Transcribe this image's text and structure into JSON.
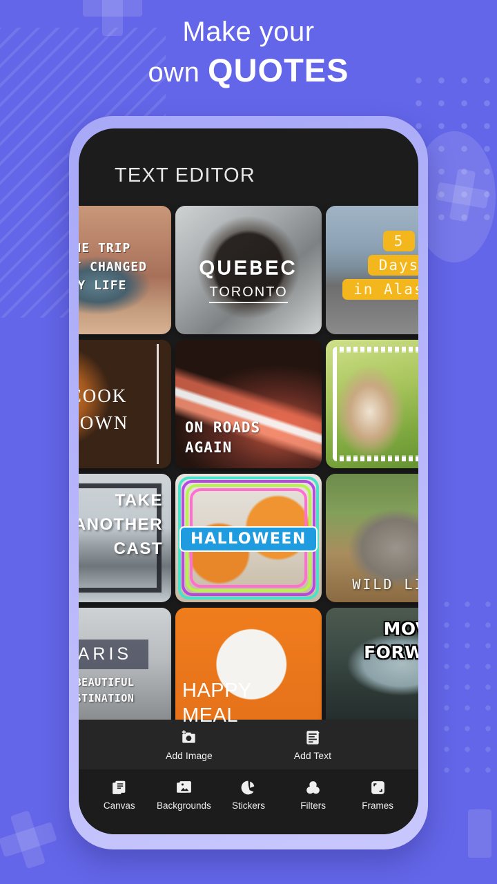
{
  "promo": {
    "line1": "Make your",
    "line2_prefix": "own ",
    "line2_emphasis": "QUOTES",
    "background_color": "#6366e8",
    "phone_frame_color": "#b6b5fb"
  },
  "app": {
    "screen_title": "TEXT EDITOR",
    "screen_background": "#1c1c1c"
  },
  "gallery": {
    "rows": [
      [
        {
          "id": "card-trip",
          "photo": "canyon",
          "lines": [
            "THE TRIP",
            "THAT CHANGED",
            "MY LIFE"
          ]
        },
        {
          "id": "card-quebec",
          "photo": "quebec-circle",
          "title": "QUEBEC",
          "subtitle": "TORONTO"
        },
        {
          "id": "card-alaska",
          "photo": "snow-road",
          "lines": [
            "5",
            "Days",
            "in Alaska"
          ],
          "highlight_color": "#f3b61c"
        }
      ],
      [
        {
          "id": "card-cooktown",
          "photo": "dog",
          "lines": [
            "COOK",
            "TOWN"
          ]
        },
        {
          "id": "card-roads",
          "photo": "light-trails",
          "lines": [
            "ON  ROADS",
            "AGAIN"
          ]
        },
        {
          "id": "card-child",
          "photo": "child-field",
          "lines": []
        }
      ],
      [
        {
          "id": "card-take",
          "photo": "mountain",
          "lines": [
            "TAKE",
            "ANOTHER",
            "CAST"
          ]
        },
        {
          "id": "card-halloween",
          "photo": "pumpkins",
          "badge": "HALLOWEEN",
          "badge_color": "#1f9be0"
        },
        {
          "id": "card-wildlife",
          "photo": "elephant",
          "lines": [
            "WILD LIFE"
          ]
        }
      ],
      [
        {
          "id": "card-paris",
          "photo": "eiffel-tower",
          "title": "PARIS",
          "lines": [
            "A BEAUTIFUL",
            "DESTINATION"
          ]
        },
        {
          "id": "card-happymeal",
          "photo": "food-plate",
          "lines": [
            "HAPPY",
            "MEAL"
          ]
        },
        {
          "id": "card-moving",
          "photo": "lake-shore",
          "lines": [
            "MOVING",
            "FORWARD"
          ]
        }
      ]
    ]
  },
  "action_bar": {
    "items": [
      {
        "icon": "add-image-icon",
        "label": "Add Image"
      },
      {
        "icon": "add-text-icon",
        "label": "Add Text"
      }
    ]
  },
  "bottom_nav": {
    "items": [
      {
        "icon": "canvas-icon",
        "label": "Canvas"
      },
      {
        "icon": "backgrounds-icon",
        "label": "Backgrounds"
      },
      {
        "icon": "stickers-icon",
        "label": "Stickers"
      },
      {
        "icon": "filters-icon",
        "label": "Filters"
      },
      {
        "icon": "frames-icon",
        "label": "Frames"
      }
    ]
  }
}
